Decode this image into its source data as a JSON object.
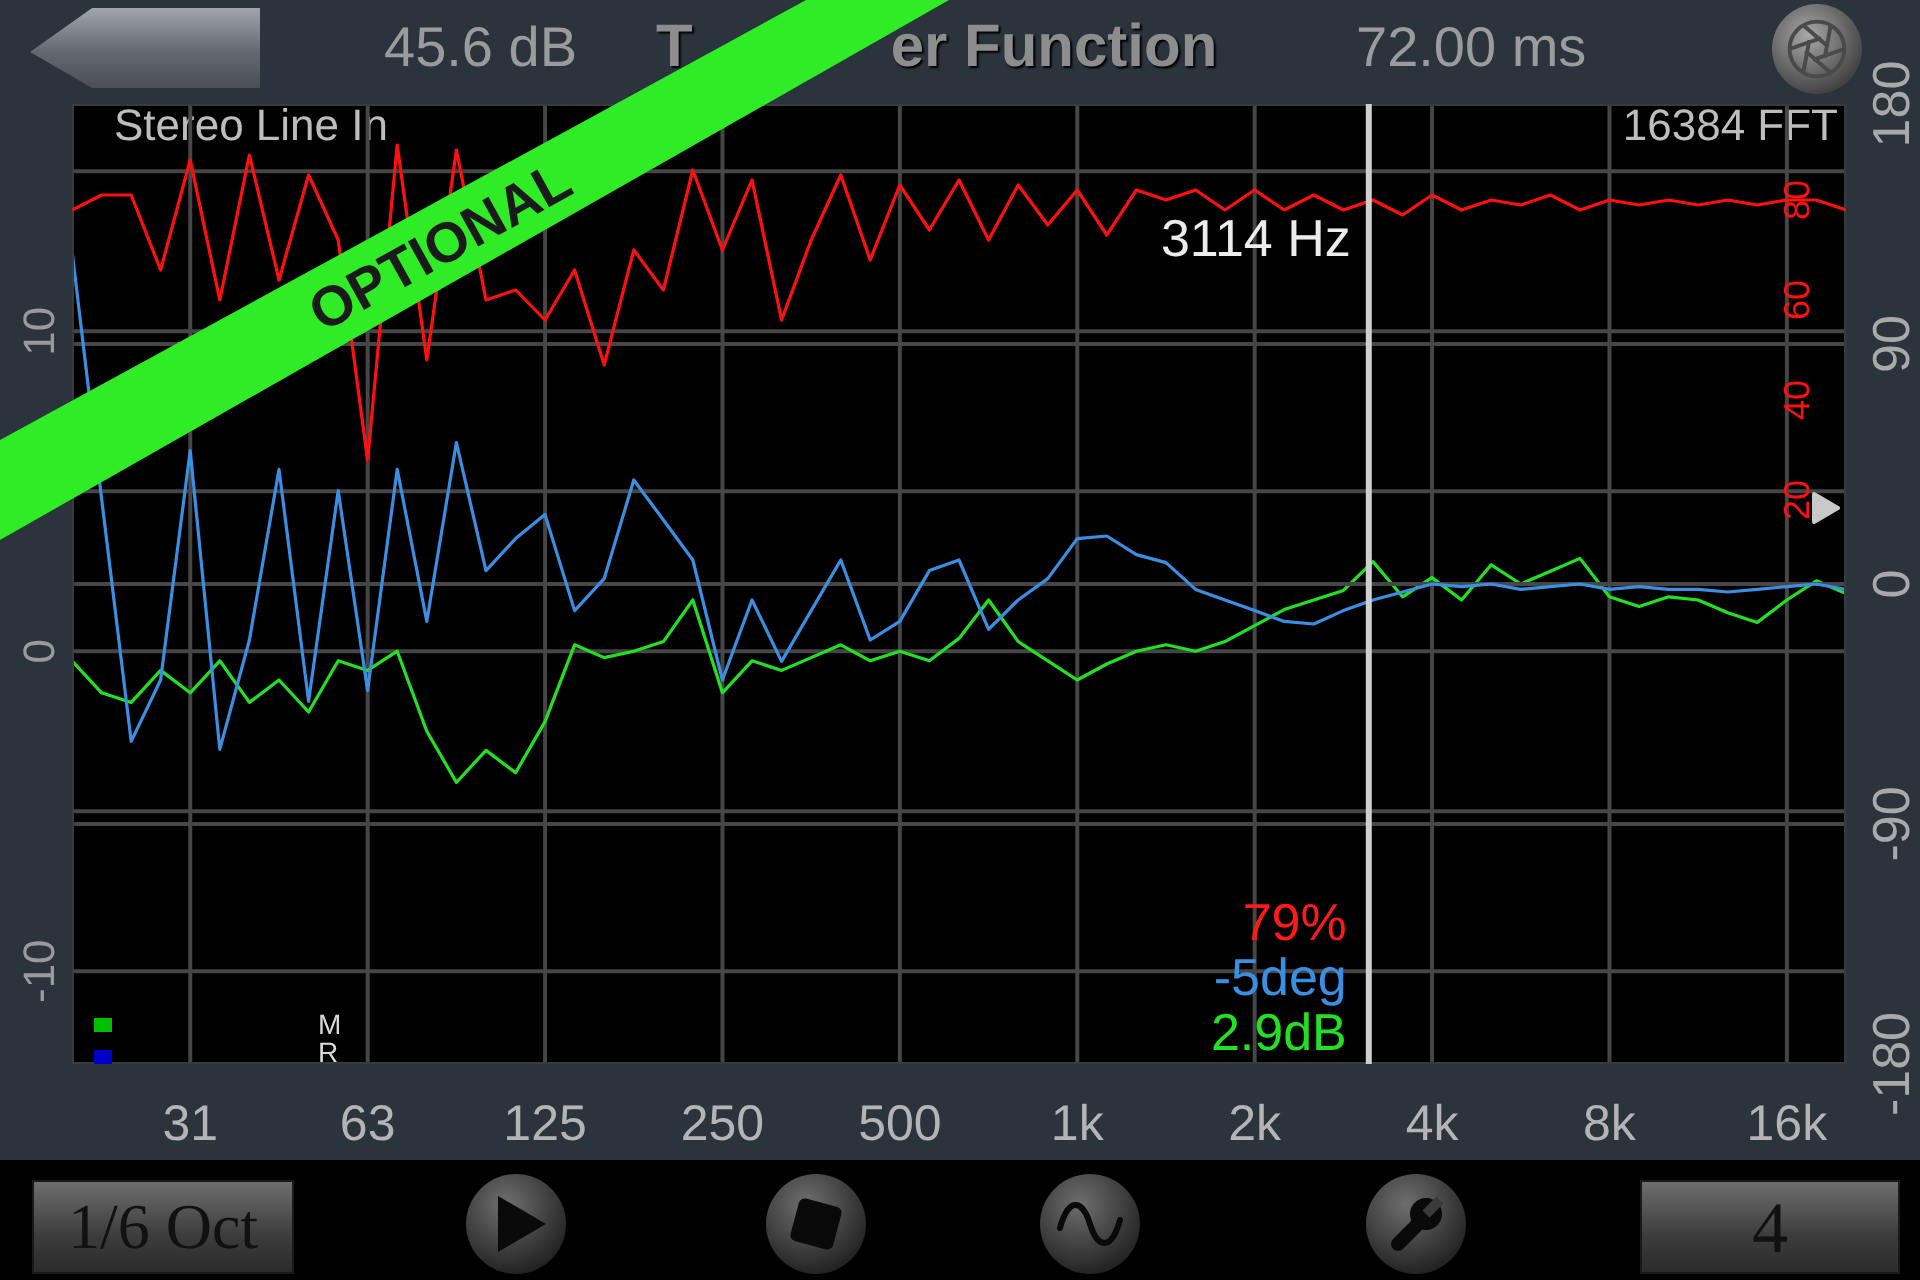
{
  "banner": {
    "text": "OPTIONAL"
  },
  "header": {
    "level_reading": "45.6 dB",
    "title_parts": [
      "T",
      "er Function"
    ],
    "time_reading": "72.00 ms"
  },
  "plot": {
    "input_label": "Stereo Line In",
    "fft_label": "16384 FFT",
    "magnitude": {
      "chart_data": {
        "type": "line",
        "grid": true,
        "categories": [
          null,
          null,
          null,
          null,
          "31",
          null,
          null,
          null,
          null,
          null,
          "63",
          null,
          null,
          null,
          null,
          null,
          "125",
          null,
          null,
          null,
          null,
          null,
          "250",
          null,
          null,
          null,
          null,
          null,
          "500",
          null,
          null,
          null,
          null,
          null,
          "1k",
          null,
          null,
          null,
          null,
          null,
          "2k",
          null,
          null,
          null,
          null,
          null,
          "4k",
          null,
          null,
          null,
          null,
          null,
          "8k",
          null,
          null,
          null,
          null,
          null,
          "16k",
          null,
          null
        ],
        "ylim": [
          -12.9,
          17.1
        ],
        "yticks": [
          10,
          0,
          -10
        ],
        "series": [
          {
            "color": "#22e022",
            "values": [
              -0.3,
              -1.3,
              -1.6,
              -0.6,
              -1.3,
              -0.3,
              -1.6,
              -0.9,
              -1.9,
              -0.3,
              -0.6,
              0,
              -2.5,
              -4.1,
              -3.1,
              -3.8,
              -2.2,
              0.2,
              -0.2,
              0,
              0.3,
              1.6,
              -1.3,
              -0.3,
              -0.6,
              -0.2,
              0.2,
              -0.3,
              0,
              -0.3,
              0.4,
              1.6,
              0.3,
              -0.3,
              -0.9,
              -0.4,
              0,
              0.2,
              0,
              0.3,
              0.8,
              1.3,
              1.6,
              1.9,
              2.8,
              1.7,
              2.3,
              1.6,
              2.7,
              2.1,
              2.5,
              2.9,
              1.7,
              1.4,
              1.7,
              1.6,
              1.2,
              0.9,
              1.6,
              2.2,
              1.8
            ]
          }
        ]
      }
    },
    "phase": {
      "chart_data": {
        "type": "line",
        "grid": true,
        "categories": [
          null,
          null,
          null,
          null,
          null,
          null,
          null,
          null,
          null,
          null,
          null,
          null,
          null,
          null,
          null,
          null,
          null,
          null,
          null,
          null,
          null,
          null,
          null,
          null,
          null,
          null,
          null,
          null,
          null,
          null,
          null,
          null,
          null,
          null,
          null,
          null,
          null,
          null,
          null,
          null,
          null,
          null,
          null,
          null,
          null,
          null,
          null,
          null,
          null,
          null,
          null,
          null,
          null,
          null,
          null,
          null,
          null,
          null,
          null,
          null,
          null
        ],
        "ylim": [
          -180,
          180
        ],
        "yticks": [
          180,
          90,
          0,
          -90,
          -180
        ],
        "series": [
          {
            "color": "#3a8fe2",
            "values": [
              125,
              32,
              -59,
              -36,
              50,
              -62,
              -21,
              43,
              -44,
              35,
              -40,
              43,
              -14,
              53,
              5,
              17,
              26,
              -10,
              2,
              39,
              24,
              9,
              -36,
              -6,
              -29,
              -10,
              9,
              -21,
              -14,
              5,
              9,
              -17,
              -6,
              2,
              17,
              18,
              11,
              8,
              -2,
              -6,
              -10,
              -14,
              -15,
              -10,
              -6,
              -3,
              0,
              -1,
              0,
              -2,
              -1,
              0,
              -2,
              -1,
              -2,
              -2,
              -3,
              -2,
              -1,
              0,
              -2
            ]
          }
        ]
      }
    },
    "coherence": {
      "chart_data": {
        "type": "line",
        "categories": [
          null,
          null,
          null,
          null,
          null,
          null,
          null,
          null,
          null,
          null,
          null,
          null,
          null,
          null,
          null,
          null,
          null,
          null,
          null,
          null,
          null,
          null,
          null,
          null,
          null,
          null,
          null,
          null,
          null,
          null,
          null,
          null,
          null,
          null,
          null,
          null,
          null,
          null,
          null,
          null,
          null,
          null,
          null,
          null,
          null,
          null,
          null,
          null,
          null,
          null,
          null,
          null,
          null,
          null,
          null,
          null,
          null,
          null,
          null,
          null,
          null
        ],
        "ylim": [
          -92.8,
          99.2
        ],
        "yticks": [
          80,
          60,
          40,
          20
        ],
        "series": [
          {
            "color": "#ff1010",
            "values": [
              78,
              81,
              81,
              66,
              88,
              60,
              89,
              64,
              85,
              72,
              28,
              91,
              48,
              90,
              60,
              62,
              56,
              66,
              47,
              70,
              62,
              86,
              70,
              84,
              56,
              72,
              85,
              68,
              83,
              74,
              84,
              72,
              83,
              75,
              82,
              73,
              82,
              80,
              82,
              78,
              82,
              78,
              81,
              78,
              80,
              77,
              81,
              78,
              80,
              79,
              81,
              78,
              80,
              79,
              80,
              79,
              80,
              79,
              80,
              80,
              78
            ]
          }
        ]
      }
    },
    "cursor": {
      "level": 0.731,
      "label": "3114 Hz"
    },
    "readouts": [
      {
        "text": "79%",
        "color": "#ff1a1a"
      },
      {
        "text": "-5deg",
        "color": "#3a8fe2"
      },
      {
        "text": "2.9dB",
        "color": "#22e022"
      }
    ],
    "legend": [
      {
        "label": "M",
        "color": "#00c000"
      },
      {
        "label": "R",
        "color": "#0000c8"
      }
    ]
  },
  "toolbar": {
    "resolution_button": "1/6 Oct",
    "count_button": "4"
  }
}
